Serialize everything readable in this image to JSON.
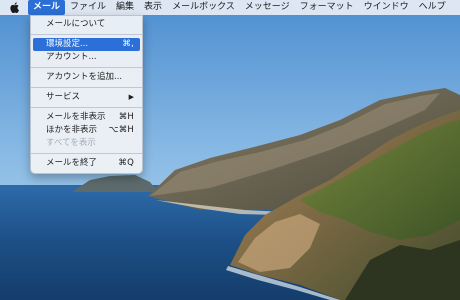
{
  "menubar": {
    "items": [
      {
        "label": "メール",
        "active": true
      },
      {
        "label": "ファイル"
      },
      {
        "label": "編集"
      },
      {
        "label": "表示"
      },
      {
        "label": "メールボックス"
      },
      {
        "label": "メッセージ"
      },
      {
        "label": "フォーマット"
      },
      {
        "label": "ウインドウ"
      },
      {
        "label": "ヘルプ"
      }
    ]
  },
  "mail_menu": {
    "about": "メールについて",
    "preferences": {
      "label": "環境設定...",
      "shortcut": "⌘,"
    },
    "accounts": "アカウント...",
    "add_account": "アカウントを追加...",
    "services": {
      "label": "サービス",
      "arrow": "▶"
    },
    "hide_mail": {
      "label": "メールを非表示",
      "shortcut": "⌘H"
    },
    "hide_others": {
      "label": "ほかを非表示",
      "shortcut": "⌥⌘H"
    },
    "show_all": "すべてを表示",
    "quit": {
      "label": "メールを終了",
      "shortcut": "⌘Q"
    }
  },
  "colors": {
    "accent": "#2b6fd6",
    "sky": "#6aa4d8",
    "sea": "#1d4f86"
  },
  "icons": {
    "apple": "apple-logo-icon",
    "submenu": "chevron-right-icon"
  }
}
